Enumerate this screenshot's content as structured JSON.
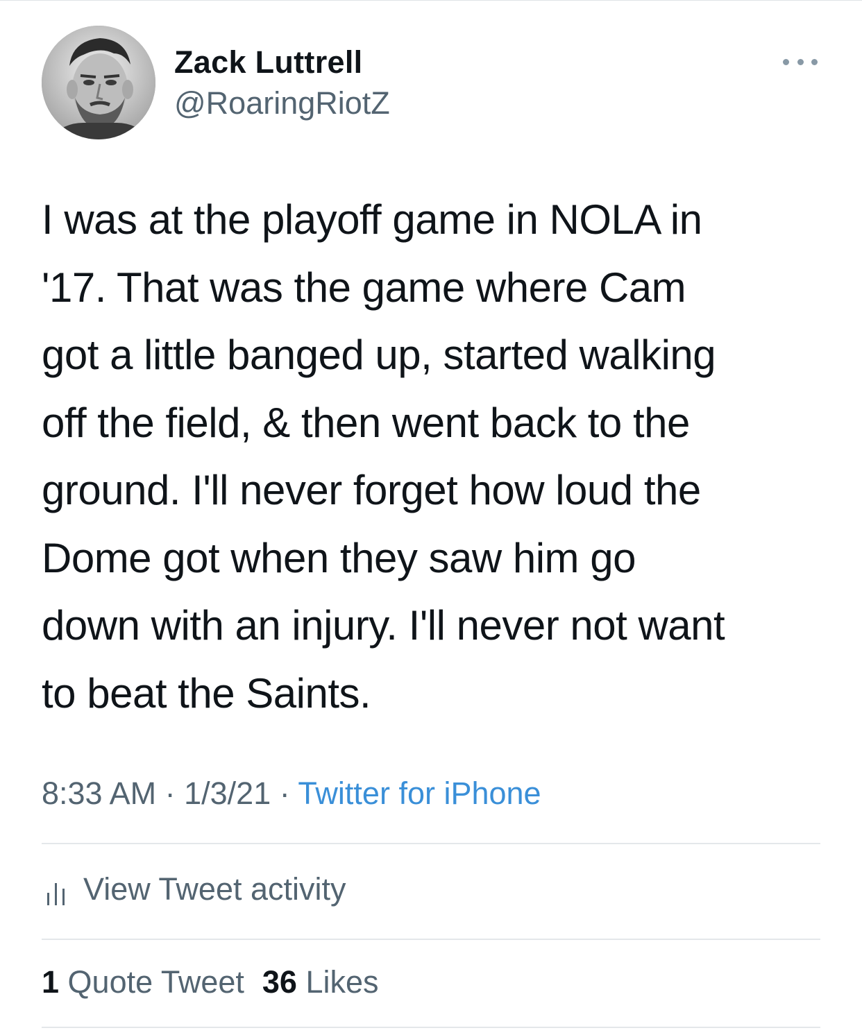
{
  "author": {
    "display_name": "Zack Luttrell",
    "handle": "@RoaringRiotZ",
    "avatar_icon": "profile-photo"
  },
  "more_icon": "ellipsis-icon",
  "tweet": {
    "lines": [
      "I was at the playoff game in NOLA in",
      "'17. That was the game where Cam",
      "got a little banged up, started walking",
      "off the field, & then went back to the",
      "ground. I'll never forget how loud the",
      "Dome got when they saw him go",
      "down with an injury. I'll never not want",
      "to beat the Saints."
    ]
  },
  "meta": {
    "time": "8:33 AM",
    "sep1": " · ",
    "date": "1/3/21",
    "sep2": " · ",
    "source": "Twitter for iPhone"
  },
  "activity": {
    "icon": "bar-chart-icon",
    "label": "View Tweet activity"
  },
  "engagement": {
    "quote_count": "1",
    "quote_label": "Quote Tweet",
    "likes_count": "36",
    "likes_label": "Likes"
  },
  "colors": {
    "text_primary": "#0f1419",
    "text_secondary": "#536471",
    "link": "#3a8fd8",
    "divider": "#e4e7ea"
  }
}
